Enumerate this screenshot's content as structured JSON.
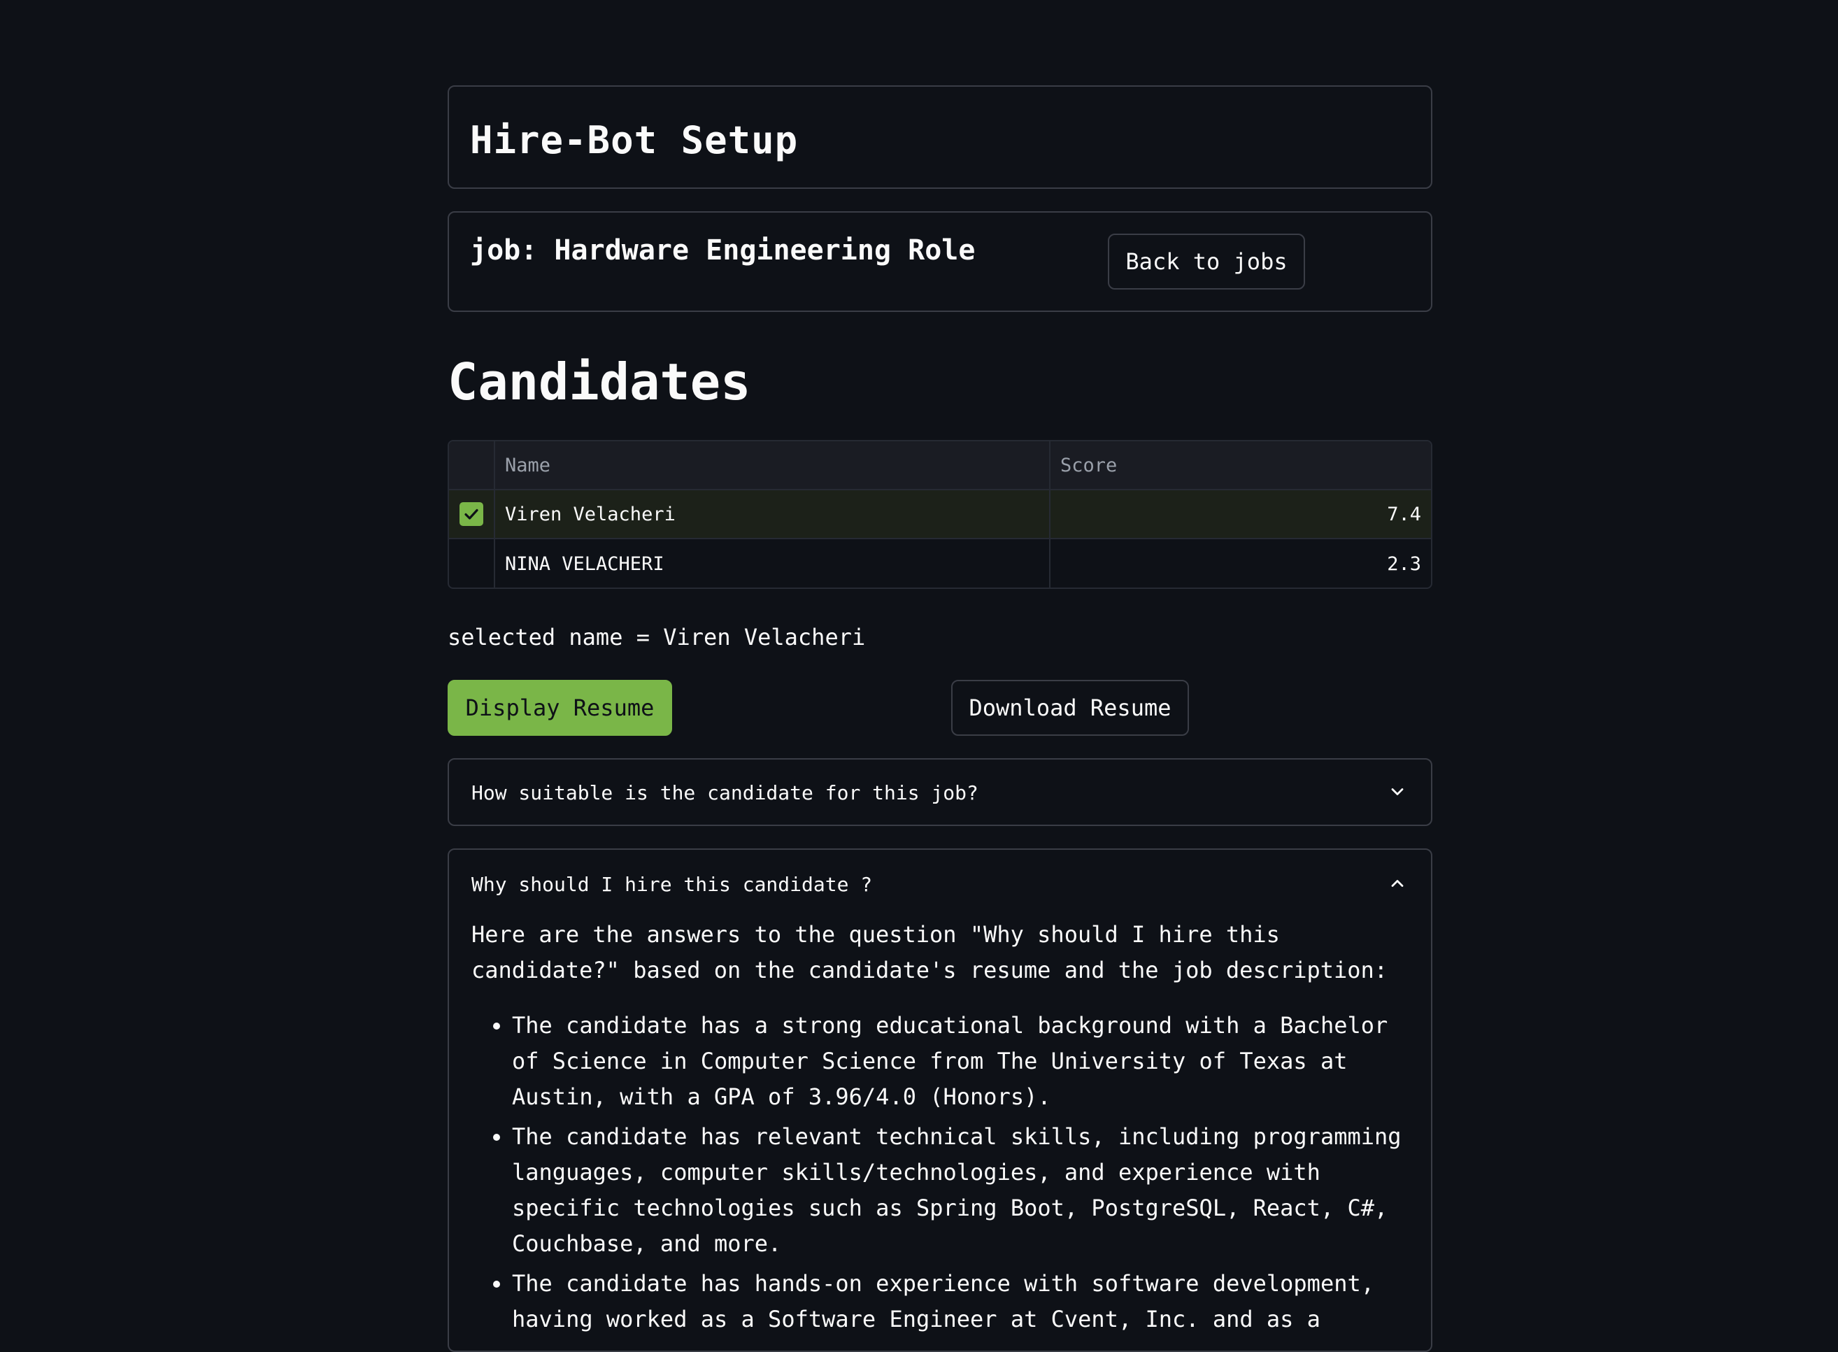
{
  "app": {
    "title": "Hire-Bot Setup"
  },
  "job": {
    "title": "job: Hardware Engineering Role",
    "back_label": "Back to jobs"
  },
  "candidates": {
    "heading": "Candidates",
    "columns": [
      "Name",
      "Score"
    ],
    "rows": [
      {
        "name": "Viren Velacheri",
        "score": "7.4",
        "selected": true
      },
      {
        "name": "NINA VELACHERI",
        "score": "2.3",
        "selected": false
      }
    ]
  },
  "selection": {
    "text": "selected name = Viren Velacheri"
  },
  "actions": {
    "display_label": "Display Resume",
    "download_label": "Download Resume"
  },
  "expanders": [
    {
      "question": "How suitable is the candidate for this job?",
      "expanded": false
    },
    {
      "question": "Why should I hire this candidate ?",
      "expanded": true,
      "intro": "Here are the answers to the question \"Why should I hire this candidate?\" based on the candidate's resume and the job description:",
      "bullets": [
        "The candidate has a strong educational background with a Bachelor of Science in Computer Science from The University of Texas at Austin, with a GPA of 3.96/4.0 (Honors).",
        "The candidate has relevant technical skills, including programming languages, computer skills/technologies, and experience with specific technologies such as Spring Boot, PostgreSQL, React, C#, Couchbase, and more.",
        "The candidate has hands-on experience with software development, having worked as a Software Engineer at Cvent, Inc. and as a"
      ]
    }
  ],
  "colors": {
    "background": "#0e1117",
    "accent": "#7ab648",
    "border": "#3a3d46",
    "text": "#fafafa"
  }
}
